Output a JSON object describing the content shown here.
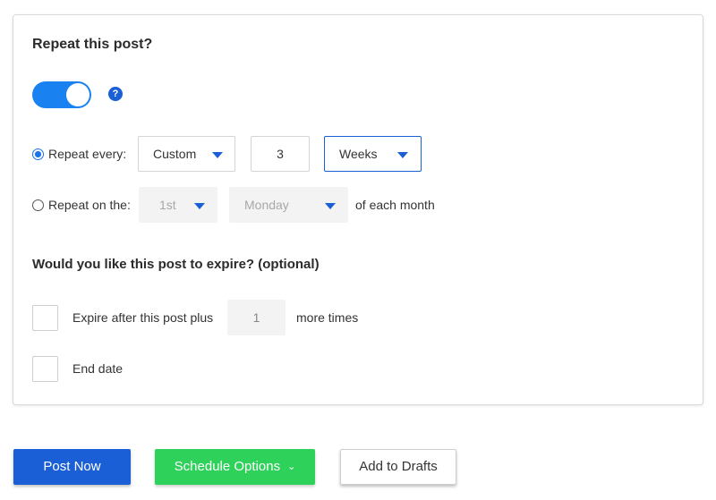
{
  "repeat_section": {
    "heading": "Repeat this post?",
    "toggle_on": true,
    "help_icon": "?",
    "repeat_every": {
      "selected": true,
      "label": "Repeat every:",
      "frequency": "Custom",
      "interval": "3",
      "unit": "Weeks"
    },
    "repeat_on": {
      "selected": false,
      "label": "Repeat on the:",
      "ordinal": "1st",
      "weekday": "Monday",
      "suffix": "of each month"
    }
  },
  "expire_section": {
    "heading": "Would you like this post to expire? (optional)",
    "expire_after": {
      "checked": false,
      "label": "Expire after this post plus",
      "count": "1",
      "suffix": "more times"
    },
    "end_date": {
      "checked": false,
      "label": "End date"
    }
  },
  "actions": {
    "post_now": "Post Now",
    "schedule_options": "Schedule Options",
    "add_to_drafts": "Add to Drafts"
  },
  "colors": {
    "primary": "#1a5fd6",
    "toggle": "#1a82f0",
    "green": "#2ed15a"
  },
  "icons": {
    "help": "question-circle-icon",
    "caret": "caret-down-icon",
    "chevron": "chevron-down-icon"
  }
}
